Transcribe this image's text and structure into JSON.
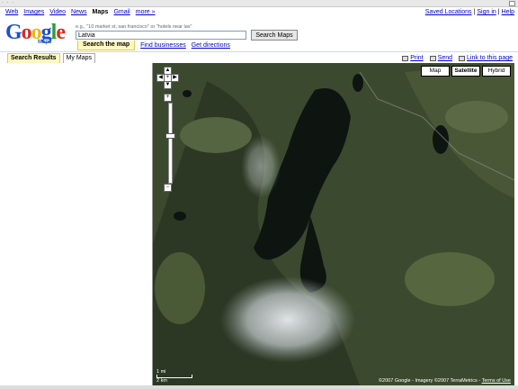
{
  "nav": {
    "web": "Web",
    "images": "Images",
    "video": "Video",
    "news": "News",
    "maps": "Maps",
    "gmail": "Gmail",
    "more": "more »"
  },
  "top_links": {
    "saved": "Saved Locations",
    "sep": "|",
    "signin": "Sign in",
    "help": "Help"
  },
  "logo": {
    "text": "Google",
    "sub": "Maps"
  },
  "search": {
    "hint": "e.g., \"10 market st, san francisco\" or \"hotels near lax\"",
    "value": "Latvia",
    "button": "Search Maps"
  },
  "subtabs": {
    "search_map": "Search the map",
    "find_businesses": "Find businesses",
    "get_directions": "Get directions"
  },
  "left_tabs": {
    "results": "Search Results",
    "mymaps": "My Maps"
  },
  "right_links": {
    "print": "Print",
    "send": "Send",
    "link": "Link to this page"
  },
  "map_types": {
    "map": "Map",
    "satellite": "Satellite",
    "hybrid": "Hybrid",
    "selected": "Satellite"
  },
  "scale": {
    "mi": "1 mi",
    "km": "2 km"
  },
  "copyright": {
    "text": "©2007 Google - Imagery ©2007 TerraMetrics - ",
    "terms": "Terms of Use"
  },
  "icons": [
    "pan-up-icon",
    "pan-left-icon",
    "pan-center-icon",
    "pan-right-icon",
    "pan-down-icon",
    "zoom-in-icon",
    "zoom-out-icon",
    "print-icon",
    "send-icon",
    "link-icon"
  ]
}
